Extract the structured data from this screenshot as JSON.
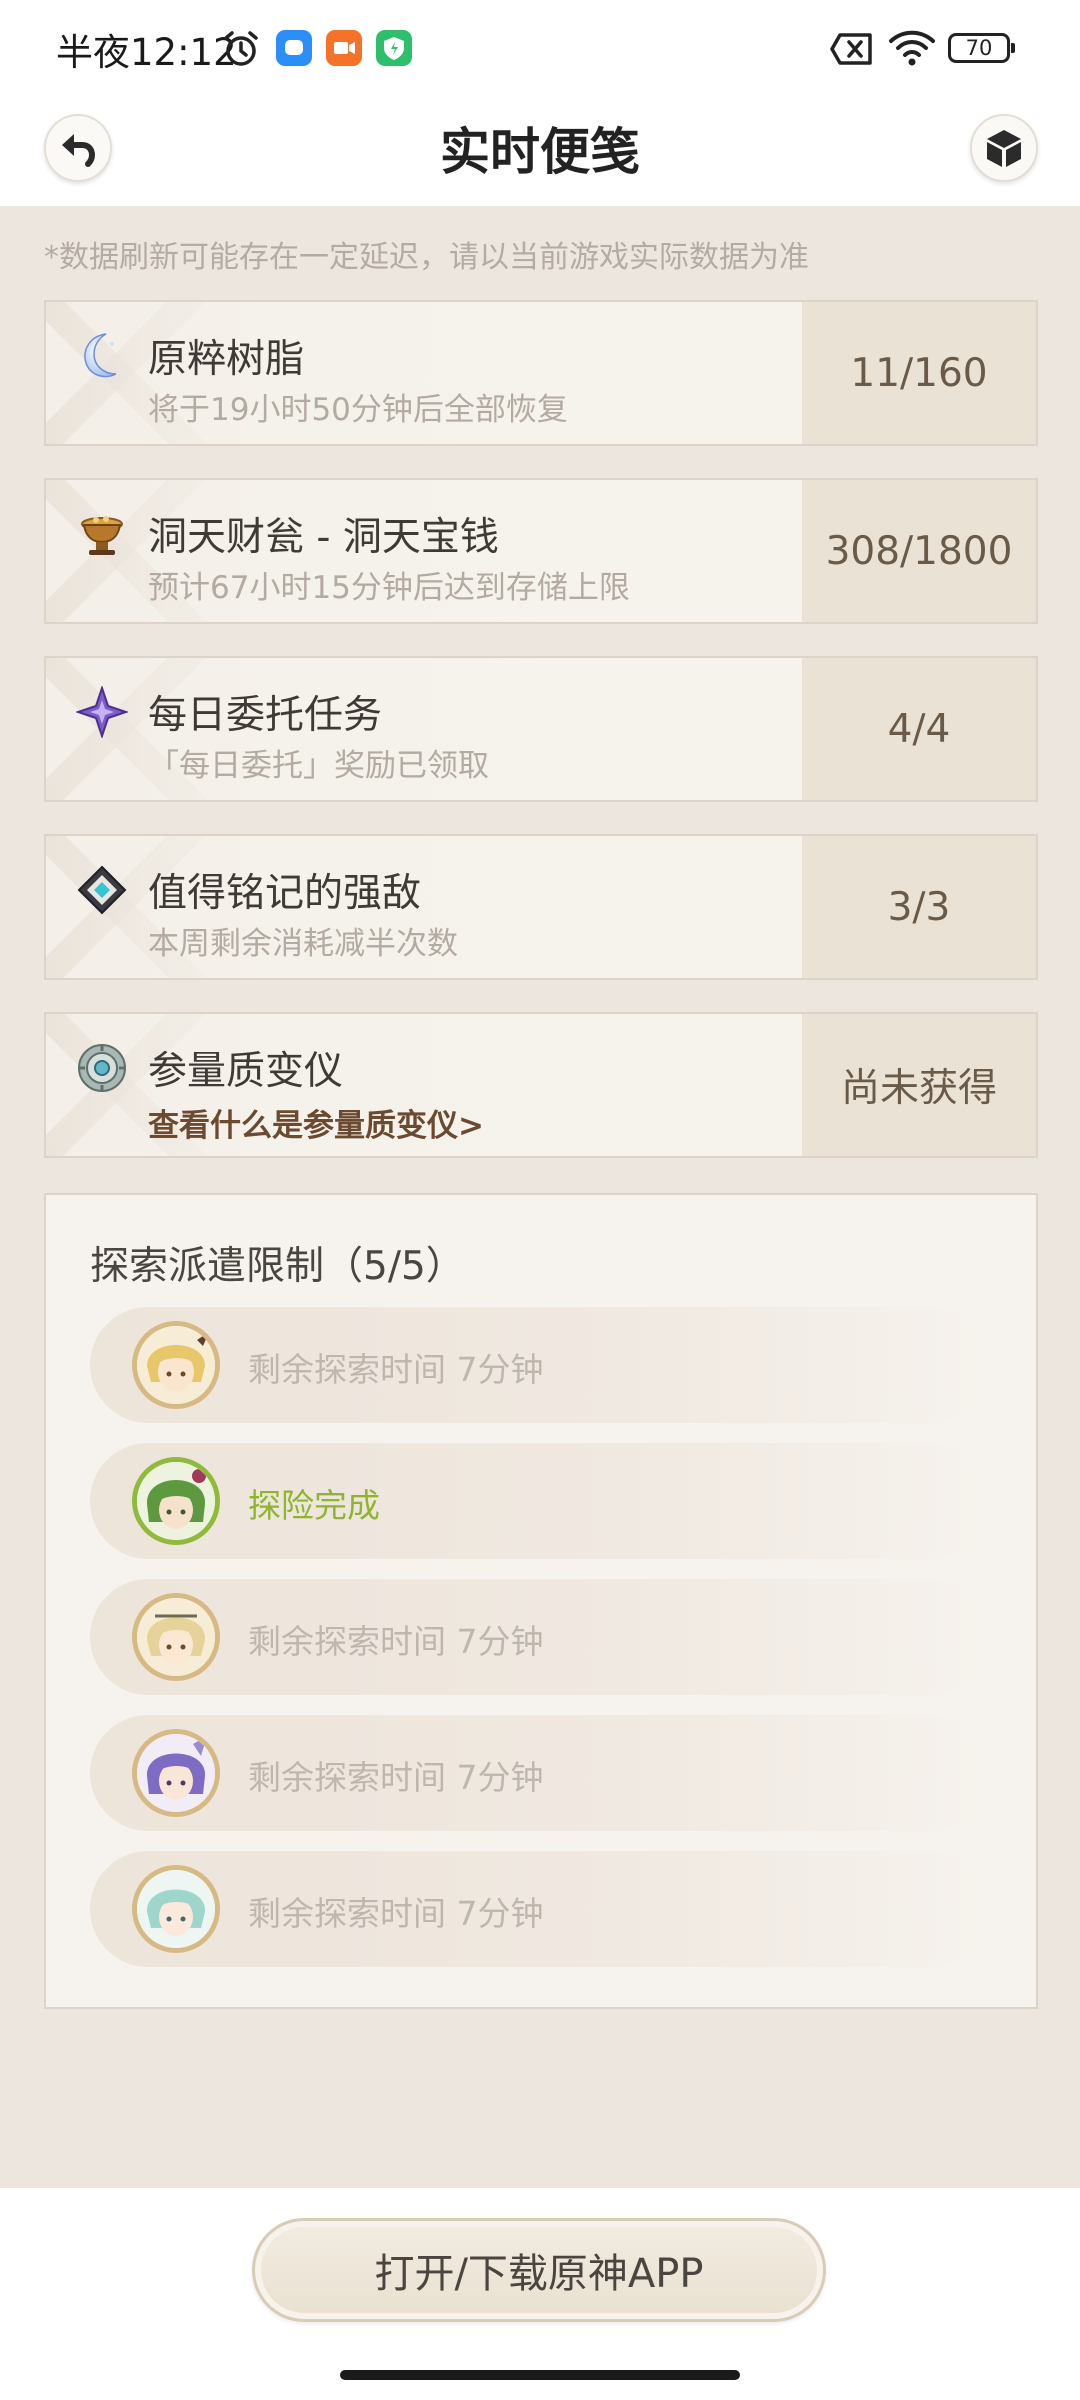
{
  "status_bar": {
    "time": "半夜12:12",
    "battery": "70"
  },
  "header": {
    "title": "实时便笺"
  },
  "notice": "*数据刷新可能存在一定延迟，请以当前游戏实际数据为准",
  "cards": [
    {
      "title": "原粹树脂",
      "subtitle": "将于19小时50分钟后全部恢复",
      "value": "11/160",
      "icon": "moon-resin-icon"
    },
    {
      "title": "洞天财瓮 - 洞天宝钱",
      "subtitle": "预计67小时15分钟后达到存储上限",
      "value": "308/1800",
      "icon": "treasure-bowl-icon"
    },
    {
      "title": "每日委托任务",
      "subtitle": "「每日委托」奖励已领取",
      "value": "4/4",
      "icon": "purple-star-icon"
    },
    {
      "title": "值得铭记的强敌",
      "subtitle": "本周剩余消耗减半次数",
      "value": "3/3",
      "icon": "teal-diamond-icon"
    },
    {
      "title": "参量质变仪",
      "link": "查看什么是参量质变仪>",
      "value": "尚未获得",
      "icon": "transformer-gear-icon"
    }
  ],
  "expedition": {
    "title": "探索派遣限制（5/5）",
    "rows": [
      {
        "status": "剩余探索时间 7分钟",
        "done": false,
        "hair": "#e8c66a",
        "skin": "#fae6cf"
      },
      {
        "status": "探险完成",
        "done": true,
        "hair": "#5d9a3f",
        "skin": "#f6e1cc"
      },
      {
        "status": "剩余探索时间 7分钟",
        "done": false,
        "hair": "#e6d399",
        "skin": "#fae8d3"
      },
      {
        "status": "剩余探索时间 7分钟",
        "done": false,
        "hair": "#7d6bc4",
        "skin": "#fae6d7"
      },
      {
        "status": "剩余探索时间 7分钟",
        "done": false,
        "hair": "#9fd6cc",
        "skin": "#fbeadb"
      }
    ]
  },
  "bottom": {
    "button_label": "打开/下载原神APP"
  }
}
